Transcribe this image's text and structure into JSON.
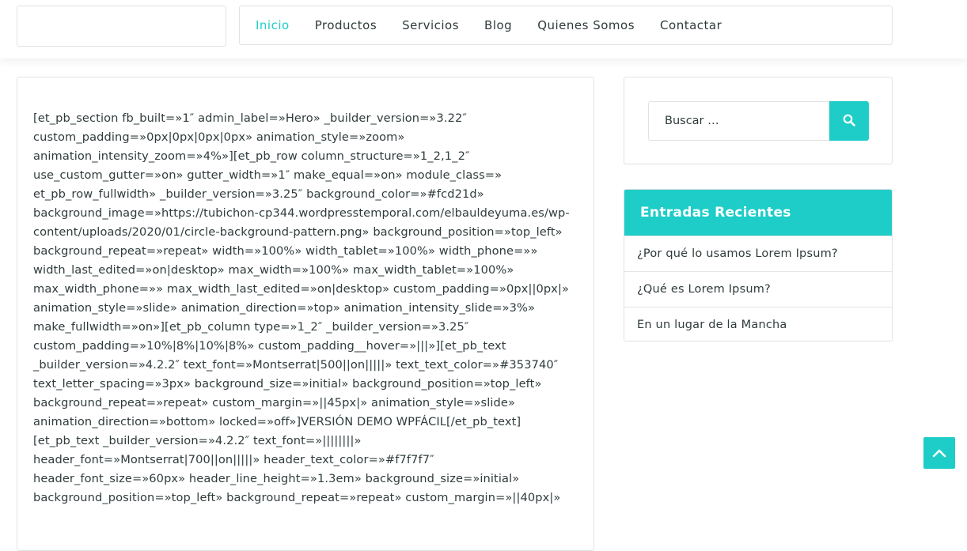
{
  "nav": {
    "items": [
      {
        "label": "Inicio",
        "active": true
      },
      {
        "label": "Productos",
        "active": false
      },
      {
        "label": "Servicios",
        "active": false
      },
      {
        "label": "Blog",
        "active": false
      },
      {
        "label": "Quienes Somos",
        "active": false
      },
      {
        "label": "Contactar",
        "active": false
      }
    ]
  },
  "content": {
    "text": "[et_pb_section fb_built=»1″ admin_label=»Hero» _builder_version=»3.22″ custom_padding=»0px|0px|0px|0px» animation_style=»zoom» animation_intensity_zoom=»4%»][et_pb_row column_structure=»1_2,1_2″ use_custom_gutter=»on» gutter_width=»1″ make_equal=»on» module_class=» et_pb_row_fullwidth» _builder_version=»3.25″ background_color=»#fcd21d» background_image=»https://tubichon-cp344.wordpresstemporal.com/elbauldeyuma.es/wp-content/uploads/2020/01/circle-background-pattern.png» background_position=»top_left» background_repeat=»repeat» width=»100%» width_tablet=»100%» width_phone=»» width_last_edited=»on|desktop» max_width=»100%» max_width_tablet=»100%» max_width_phone=»» max_width_last_edited=»on|desktop» custom_padding=»0px||0px|» animation_style=»slide» animation_direction=»top» animation_intensity_slide=»3%» make_fullwidth=»on»][et_pb_column type=»1_2″ _builder_version=»3.25″ custom_padding=»10%|8%|10%|8%» custom_padding__hover=»|||»][et_pb_text _builder_version=»4.2.2″ text_font=»Montserrat|500||on|||||» text_text_color=»#353740″ text_letter_spacing=»3px» background_size=»initial» background_position=»top_left» background_repeat=»repeat» custom_margin=»||45px|» animation_style=»slide» animation_direction=»bottom» locked=»off»]VERSIÓN DEMO WPFÁCIL[/et_pb_text][et_pb_text _builder_version=»4.2.2″ text_font=»||||||||» header_font=»Montserrat|700||on|||||» header_text_color=»#f7f7f7″ header_font_size=»60px» header_line_height=»1.3em» background_size=»initial» background_position=»top_left» background_repeat=»repeat» custom_margin=»||40px|»"
  },
  "search": {
    "placeholder": "Buscar …",
    "button_icon": "search-icon"
  },
  "recent": {
    "title": "Entradas Recientes",
    "items": [
      "¿Por qué lo usamos Lorem Ipsum?",
      "¿Qué es Lorem Ipsum?",
      "En un lugar de la Mancha"
    ]
  },
  "scroll_top": {
    "icon": "chevron-up-icon"
  },
  "colors": {
    "accent": "#1ecdc8",
    "text": "#2f3b3c",
    "border": "#e2e2e2"
  }
}
